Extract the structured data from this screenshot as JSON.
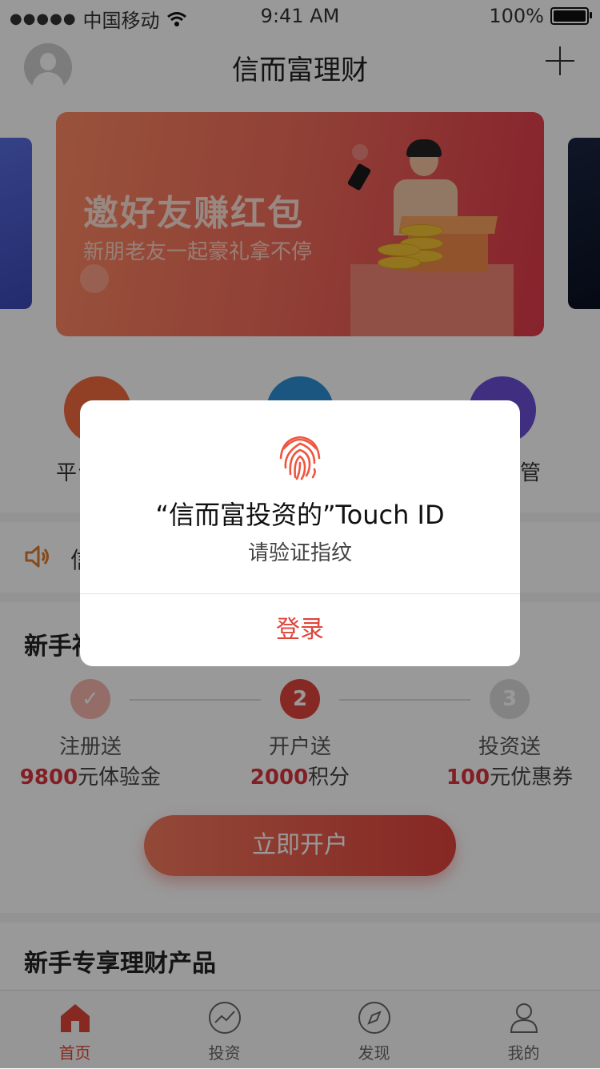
{
  "status_bar": {
    "carrier": "中国移动",
    "time": "9:41 AM",
    "battery": "100%"
  },
  "header": {
    "title": "信而富理财"
  },
  "banner": {
    "title": "邀好友赚红包",
    "subtitle": "新朋老友一起豪礼拿不停"
  },
  "quick_menu": {
    "items": [
      {
        "label": "平台",
        "icon": "platform-icon",
        "color": "#f2693e"
      },
      {
        "label": "",
        "icon": "shield-icon",
        "color": "#2e8fd6"
      },
      {
        "label": "存管",
        "icon": "custody-icon",
        "color": "#6b4fd8"
      }
    ]
  },
  "notice": {
    "text": "信"
  },
  "newuser": {
    "title": "新手福利",
    "steps": [
      {
        "badge": "✓",
        "label": "注册送",
        "reward_num": "9800",
        "reward_unit": "元体验金"
      },
      {
        "badge": "2",
        "label": "开户送",
        "reward_num": "2000",
        "reward_unit": "积分"
      },
      {
        "badge": "3",
        "label": "投资送",
        "reward_num": "100",
        "reward_unit": "元优惠券"
      }
    ],
    "cta": "立即开户"
  },
  "products": {
    "title": "新手专享理财产品"
  },
  "tabbar": {
    "tabs": [
      {
        "label": "首页",
        "icon": "home-icon"
      },
      {
        "label": "投资",
        "icon": "chart-icon"
      },
      {
        "label": "发现",
        "icon": "compass-icon"
      },
      {
        "label": "我的",
        "icon": "user-icon"
      }
    ]
  },
  "dialog": {
    "title": "“信而富投资的”Touch ID",
    "message": "请验证指纹",
    "button": "登录"
  },
  "colors": {
    "accent": "#e0453c",
    "overlay": "rgba(0,0,0,0.40)"
  }
}
